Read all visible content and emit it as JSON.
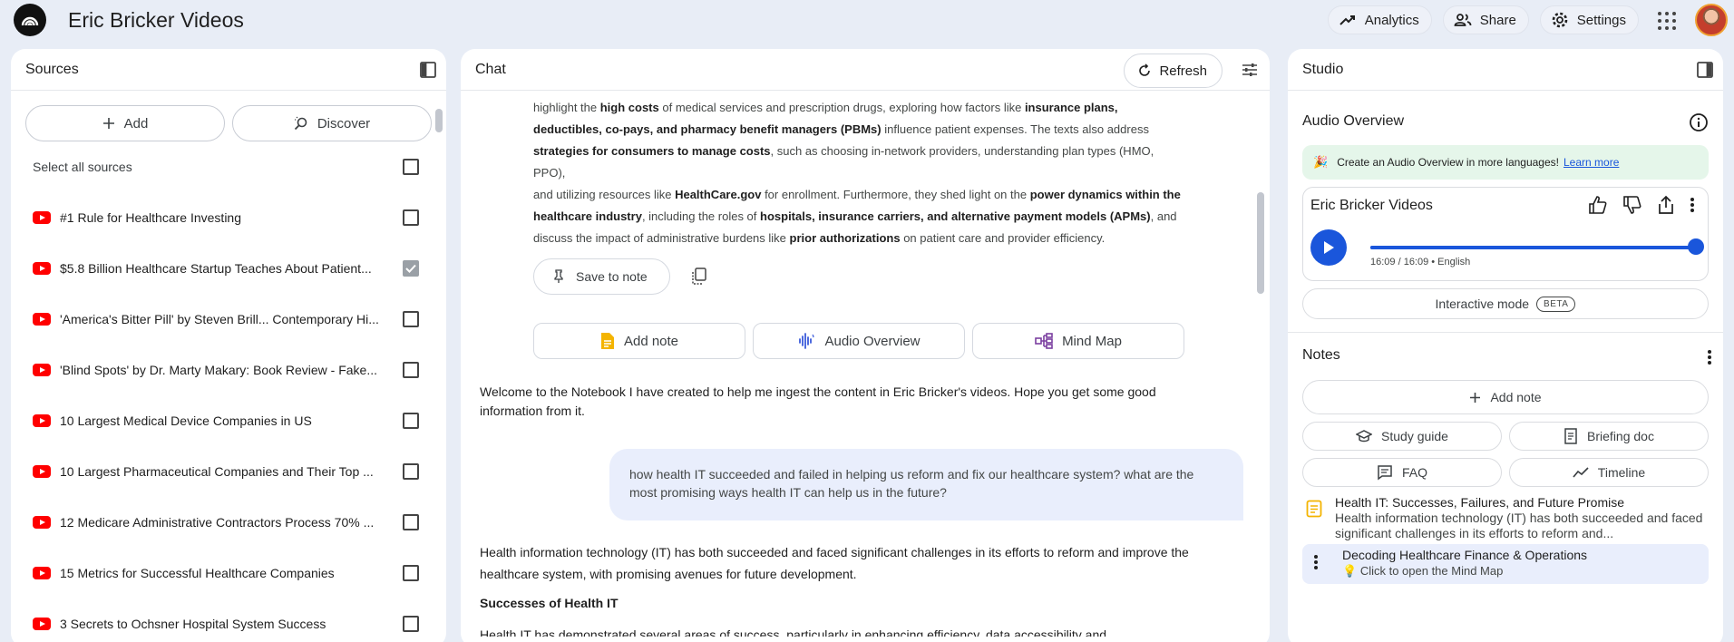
{
  "app": {
    "title": "Eric Bricker Videos"
  },
  "topbar": {
    "analytics": "Analytics",
    "share": "Share",
    "settings": "Settings"
  },
  "sources": {
    "title": "Sources",
    "add": "Add",
    "discover": "Discover",
    "select_all": "Select all sources",
    "items": [
      {
        "label": "#1 Rule for Healthcare Investing",
        "checked": false
      },
      {
        "label": "$5.8 Billion Healthcare Startup Teaches About Patient...",
        "checked": true
      },
      {
        "label": "'America's Bitter Pill' by Steven Brill... Contemporary Hi...",
        "checked": false
      },
      {
        "label": "'Blind Spots' by Dr. Marty Makary: Book Review - Fake...",
        "checked": false
      },
      {
        "label": "10 Largest Medical Device Companies in US",
        "checked": false
      },
      {
        "label": "10 Largest Pharmaceutical Companies and Their Top ...",
        "checked": false
      },
      {
        "label": "12 Medicare Administrative Contractors Process 70% ...",
        "checked": false
      },
      {
        "label": "15 Metrics for Successful Healthcare Companies",
        "checked": false
      },
      {
        "label": "3 Secrets to Ochsner Hospital System Success",
        "checked": false
      }
    ]
  },
  "chat": {
    "title": "Chat",
    "refresh": "Refresh",
    "response": {
      "l1a": "highlight the ",
      "l1b": "high costs",
      "l1c": " of medical services and prescription drugs, exploring how factors like ",
      "l1d": "insurance plans,",
      "l2a": "deductibles, co-pays, and pharmacy benefit managers (PBMs)",
      "l2b": " influence patient expenses. The texts also address",
      "l3a": "strategies for consumers to manage costs",
      "l3b": ", such as choosing in-network providers, understanding plan types (HMO, PPO),",
      "l4a": "and utilizing resources like ",
      "l4b": "HealthCare.gov",
      "l4c": " for enrollment. Furthermore, they shed light on the ",
      "l4d": "power dynamics within the",
      "l5a": "healthcare industry",
      "l5b": ", including the roles of ",
      "l5c": "hospitals, insurance carriers, and alternative payment models (APMs)",
      "l5d": ", and",
      "l6a": "discuss the impact of administrative burdens like ",
      "l6b": "prior authorizations",
      "l6c": " on patient care and provider efficiency."
    },
    "save_to_note": "Save to note",
    "suggestions": {
      "add_note": "Add note",
      "audio_overview": "Audio Overview",
      "mind_map": "Mind Map"
    },
    "welcome": "Welcome to the Notebook I have created to help me ingest the content in Eric Bricker's videos. Hope you get some good information from it.",
    "user_message": "how health IT succeeded and failed in helping us reform and fix our healthcare system? what are the most promising ways health IT can help us in the future?",
    "answer": "Health information technology (IT) has both succeeded and faced significant challenges in its efforts to reform and improve the healthcare system, with promising avenues for future development.",
    "answer_heading": "Successes of Health IT",
    "answer_cut": "Health IT has demonstrated several areas of success, particularly in enhancing efficiency, data accessibility and"
  },
  "studio": {
    "title": "Studio",
    "audio_overview_title": "Audio Overview",
    "banner_text": "Create an Audio Overview in more languages!",
    "banner_link": "Learn more",
    "card_title": "Eric Bricker Videos",
    "progress_fraction": 1.0,
    "meta": "16:09 / 16:09 • English",
    "interactive_mode": "Interactive mode",
    "beta": "BETA",
    "notes_title": "Notes",
    "add_note": "Add note",
    "study_guide": "Study guide",
    "briefing_doc": "Briefing doc",
    "faq": "FAQ",
    "timeline": "Timeline",
    "note1_title": "Health IT: Successes, Failures, and Future Promise",
    "note1_sub": "Health information technology (IT) has both succeeded and faced significant challenges in its efforts to reform and...",
    "note2_title": "Decoding Healthcare Finance & Operations",
    "note2_sub": "Click to open the Mind Map"
  },
  "colors": {
    "accent": "#1a56db",
    "youtube": "#ff0000",
    "banner": "#e5f6ea",
    "user_bubble": "#e9eefc"
  }
}
